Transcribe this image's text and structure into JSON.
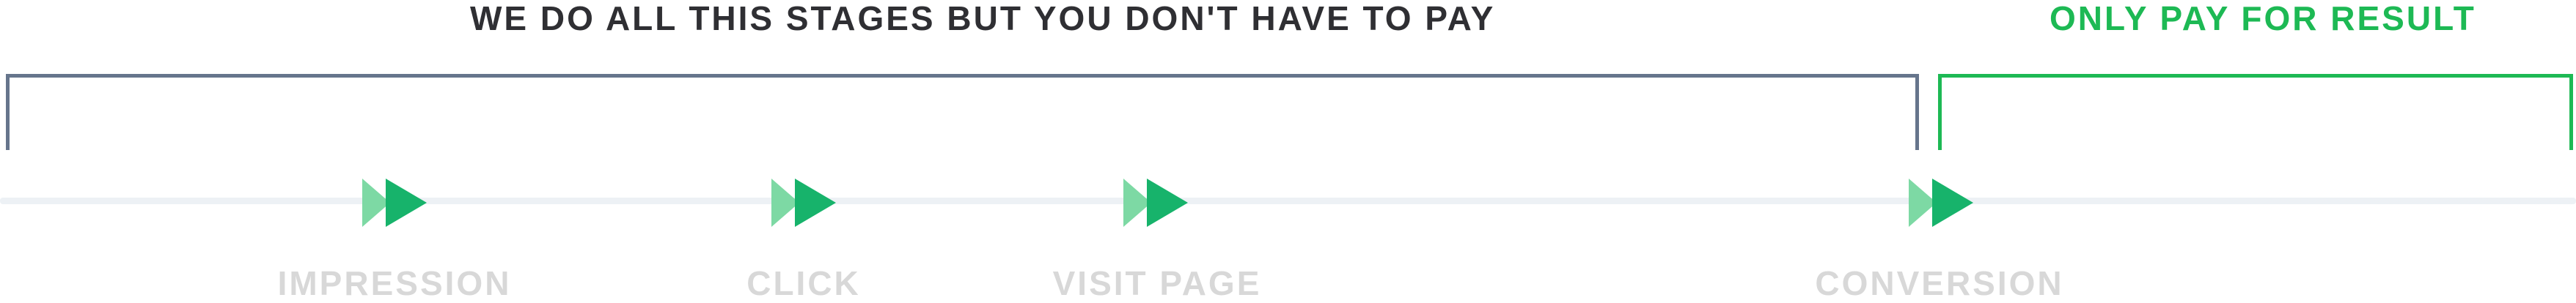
{
  "header": {
    "free_stages_heading": "WE DO ALL THIS STAGES BUT YOU DON'T HAVE TO PAY",
    "pay_heading": "ONLY PAY FOR RESULT"
  },
  "stages": [
    {
      "label": "IMPRESSION"
    },
    {
      "label": "CLICK"
    },
    {
      "label": "VISIT PAGE"
    },
    {
      "label": "CONVERSION"
    }
  ],
  "colors": {
    "free_bracket": "#66758c",
    "pay_accent": "#1db954",
    "arrow_light": "#7dd9a4",
    "arrow_dark": "#17b36b",
    "timeline": "#edf1f5",
    "stage_label": "#d8d8d8"
  },
  "icons": {
    "stage_marker": "fast-forward-icon"
  }
}
